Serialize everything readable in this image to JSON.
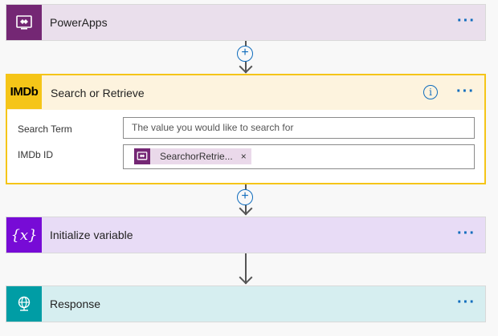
{
  "steps": {
    "powerapps": {
      "title": "PowerApps",
      "more": "···",
      "icon": "powerapps-icon"
    },
    "imdb": {
      "title": "Search or Retrieve",
      "logo": "IMDb",
      "info": "i",
      "more": "···",
      "fields": {
        "search_term": {
          "label": "Search Term",
          "placeholder": "The value you would like to search for"
        },
        "imdb_id": {
          "label": "IMDb ID",
          "token_label": "SearchorRetrie...",
          "token_remove": "×"
        }
      }
    },
    "initvar": {
      "title": "Initialize variable",
      "more": "···",
      "icon": "variable-icon",
      "glyph": "{x}"
    },
    "response": {
      "title": "Response",
      "more": "···",
      "icon": "globe-icon"
    }
  },
  "connectors": {
    "add_label": "+"
  },
  "colors": {
    "powerapps": "#742774",
    "imdb": "#f5c518",
    "variable": "#770bd6",
    "response": "#009da5",
    "link": "#0f6cbd"
  }
}
